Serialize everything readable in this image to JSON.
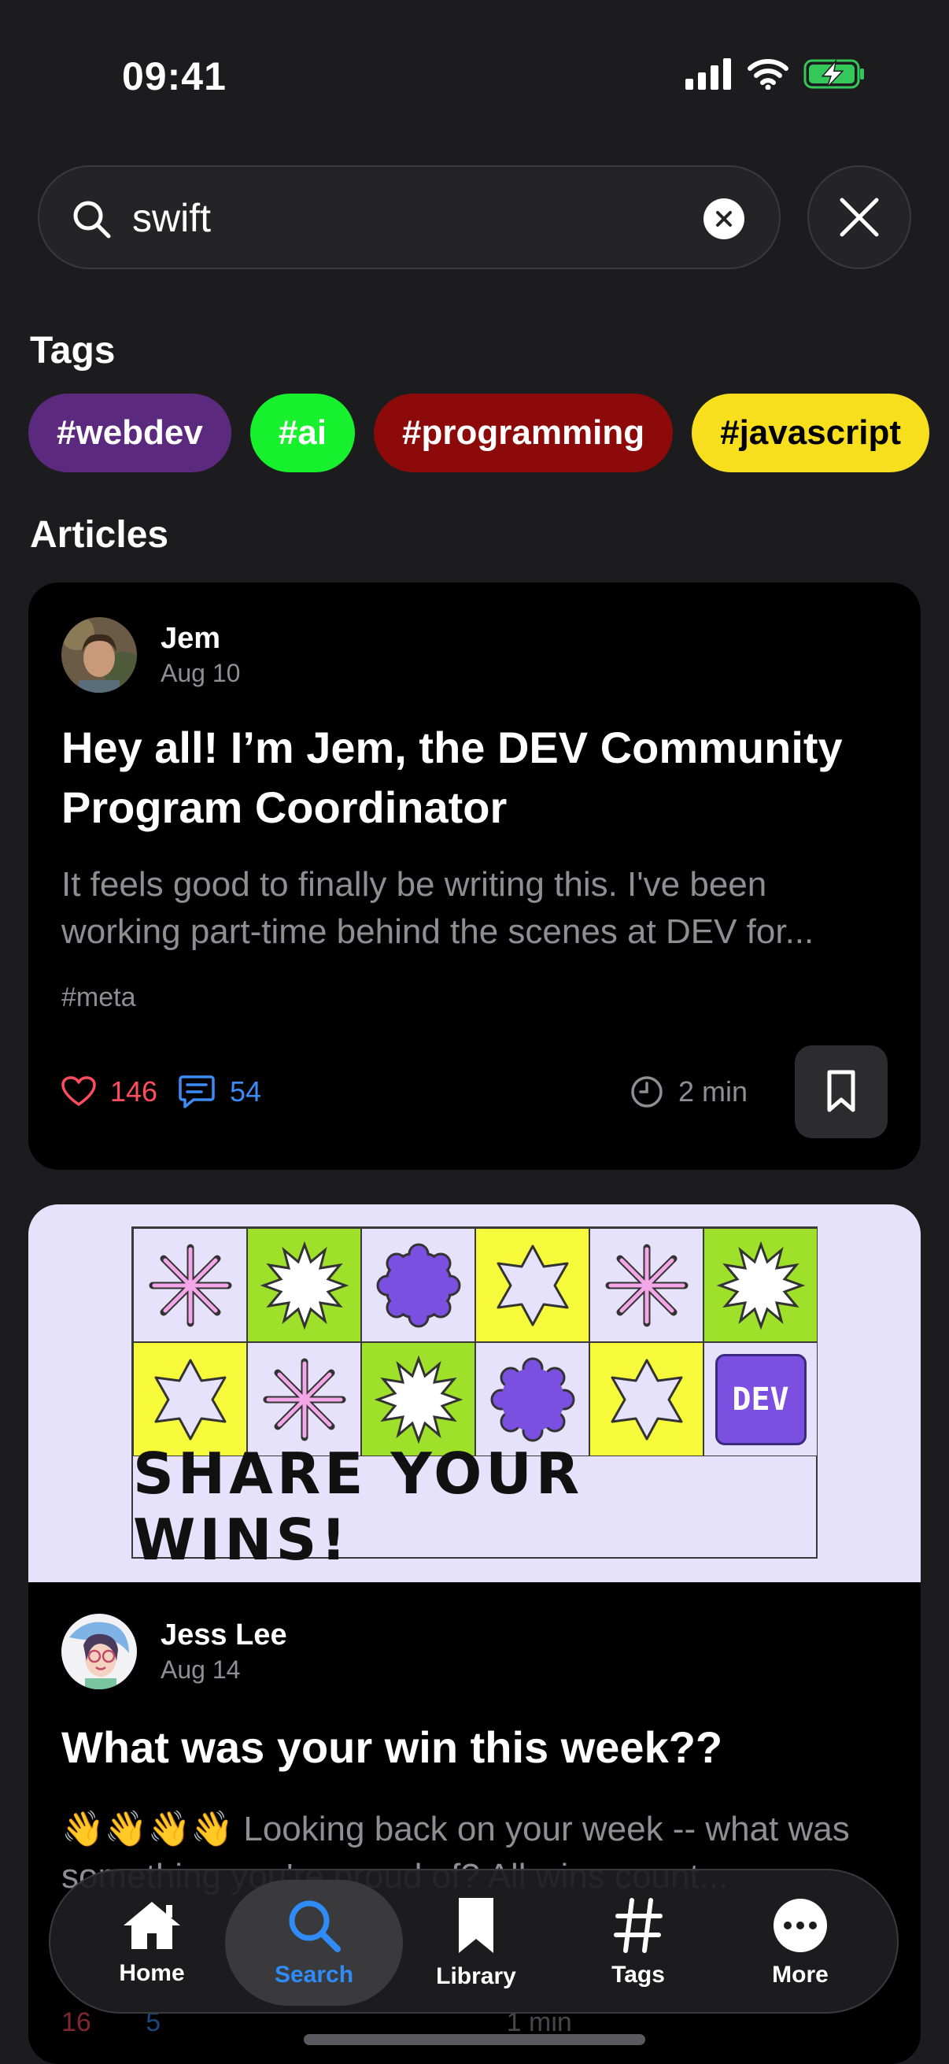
{
  "status_bar": {
    "time": "09:41"
  },
  "search": {
    "query": "swift"
  },
  "tags_section": {
    "title": "Tags",
    "tags": [
      {
        "label": "#webdev",
        "bg": "#5b2a7f",
        "fg": "#ffffff"
      },
      {
        "label": "#ai",
        "bg": "#17f02c",
        "fg": "#ffffff"
      },
      {
        "label": "#programming",
        "bg": "#8c0a0a",
        "fg": "#ffffff"
      },
      {
        "label": "#javascript",
        "bg": "#f7df1e",
        "fg": "#000000"
      }
    ]
  },
  "articles_section": {
    "title": "Articles",
    "articles": [
      {
        "author": "Jem",
        "date": "Aug 10",
        "title": "Hey all! I’m Jem, the DEV Community Program Coordinator",
        "excerpt": "It feels good to finally be writing this.  I've been working part-time behind the scenes at DEV for...",
        "hashtag": "#meta",
        "likes": "146",
        "comments": "54",
        "read_time": "2 min"
      },
      {
        "author": "Jess Lee",
        "date": "Aug 14",
        "title": "What was your win this week??",
        "excerpt": "👋👋👋👋 Looking back on your week -- what was something you're proud of? All wins count...",
        "cover_banner": "SHARE YOUR WINS!",
        "cover_logo": "DEV",
        "likes": "16",
        "comments": "5",
        "read_time": "1 min"
      }
    ]
  },
  "tab_bar": {
    "tabs": [
      {
        "label": "Home",
        "icon": "house-icon"
      },
      {
        "label": "Search",
        "icon": "search-icon",
        "active": true
      },
      {
        "label": "Library",
        "icon": "bookmark-icon"
      },
      {
        "label": "Tags",
        "icon": "hash-icon"
      },
      {
        "label": "More",
        "icon": "ellipsis-icon"
      }
    ]
  },
  "colors": {
    "background": "#1c1c1e",
    "card": "#000000",
    "accent": "#2f8cf7",
    "like": "#ff4d5e",
    "comment": "#3b8cf5"
  }
}
